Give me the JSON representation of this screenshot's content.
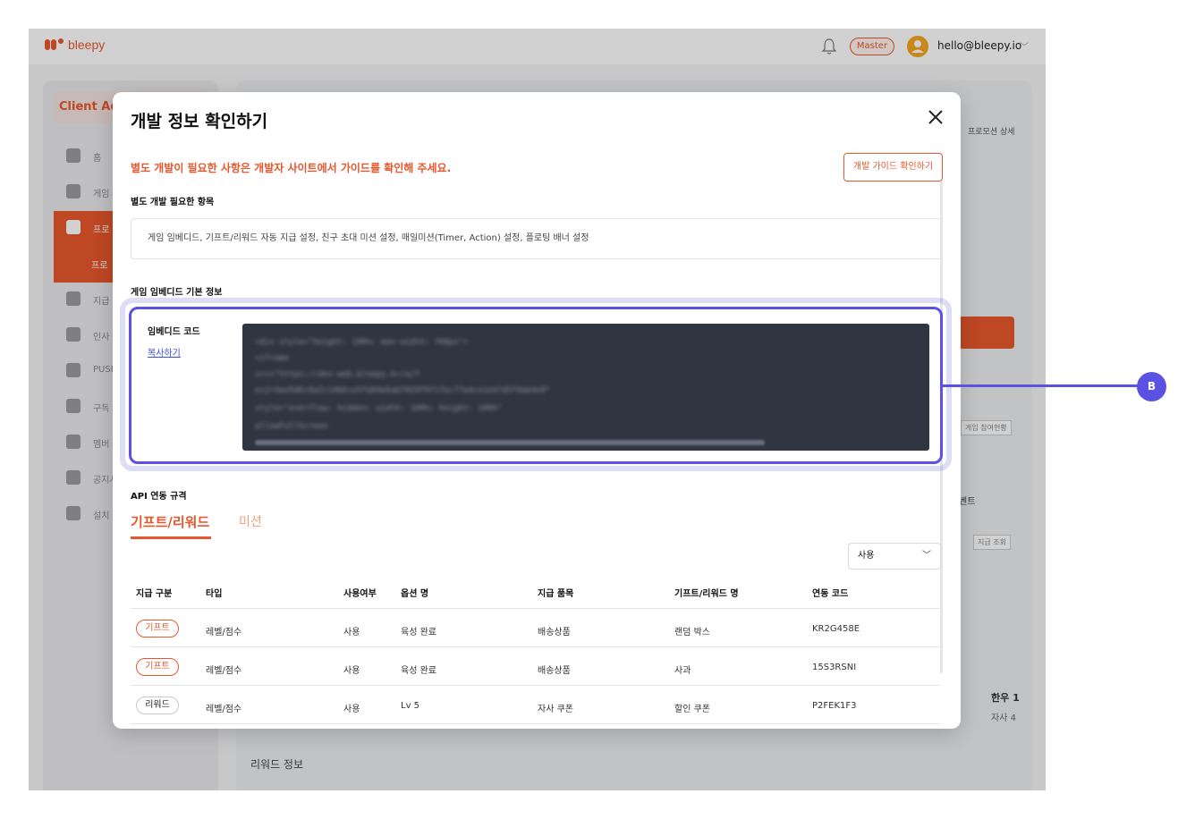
{
  "app": {
    "logo_text": "bleepy",
    "role_badge": "Master",
    "user_email": "hello@bleepy.io",
    "brand_color": "#e8572c",
    "highlight_color": "#5b52e3"
  },
  "background": {
    "sidebar_title": "Client Adr",
    "sidebar_items": [
      "홈",
      "게임",
      "프로",
      "프로",
      "지급",
      "인사",
      "PUSI",
      "구독",
      "멤버",
      "공지시",
      "설치"
    ],
    "breadcrumb_tail": "프로모션 상세",
    "chip_1": "게임 참여현황",
    "chip_2": "지급 조회",
    "side_label_1": "벤트",
    "side_label_2": "한우 1",
    "side_label_3": "자사 4",
    "reward_title": "리워드 정보"
  },
  "modal": {
    "title": "개발 정보 확인하기",
    "notice": "별도 개발이 필요한 사항은 개발자 사이트에서 가이드를 확인해 주세요.",
    "guide_button": "개발 가이드 확인하기",
    "dev_items_label": "별도 개발 필요한 항목",
    "dev_items_text": "게임 임베디드, 기프트/리워드 자동 지급 설정, 친구 초대 미션 설정, 매일미션(Timer, Action) 설정, 플로팅 배너 설정",
    "embed_section_label": "게임 임베디드 기본 정보",
    "embed": {
      "code_label": "임베디드 코드",
      "copy_link": "복사하기",
      "code_lines": [
        "<div style=\"height: 100%; max-width: 768px\">",
        "   <iframe",
        "      src=\"https://dev-web.bleepy.kr/a/f",
        "es2r4ee5d6c8a2c14b6ce5fa84e6ab7829f9f1fec77e4ce1e47d5f9ab4e0\"",
        "      style=\"overflow: hidden; width: 100%; height: 100%\"",
        "      allowFullScreen"
      ]
    },
    "api_label": "API 연동 규격",
    "tabs": [
      "기프트/리워드",
      "미션"
    ],
    "use_select": "사용",
    "table": {
      "headers": [
        "지급 구분",
        "타입",
        "사용여부",
        "옵션 명",
        "지급 품목",
        "기프트/리워드 명",
        "연동 코드"
      ],
      "rows": [
        {
          "kind": "기프트",
          "type": "레벨/점수",
          "use": "사용",
          "option": "육성 완료",
          "item": "배송상품",
          "name": "랜덤 박스",
          "code": "KR2G458E"
        },
        {
          "kind": "기프트",
          "type": "레벨/점수",
          "use": "사용",
          "option": "육성 완료",
          "item": "배송상품",
          "name": "사과",
          "code": "15S3RSNI"
        },
        {
          "kind": "리워드",
          "type": "레벨/점수",
          "use": "사용",
          "option": "Lv 5",
          "item": "자사 쿠폰",
          "name": "할인 쿠폰",
          "code": "P2FEK1F3"
        }
      ]
    }
  },
  "annotation": {
    "badge": "B"
  }
}
